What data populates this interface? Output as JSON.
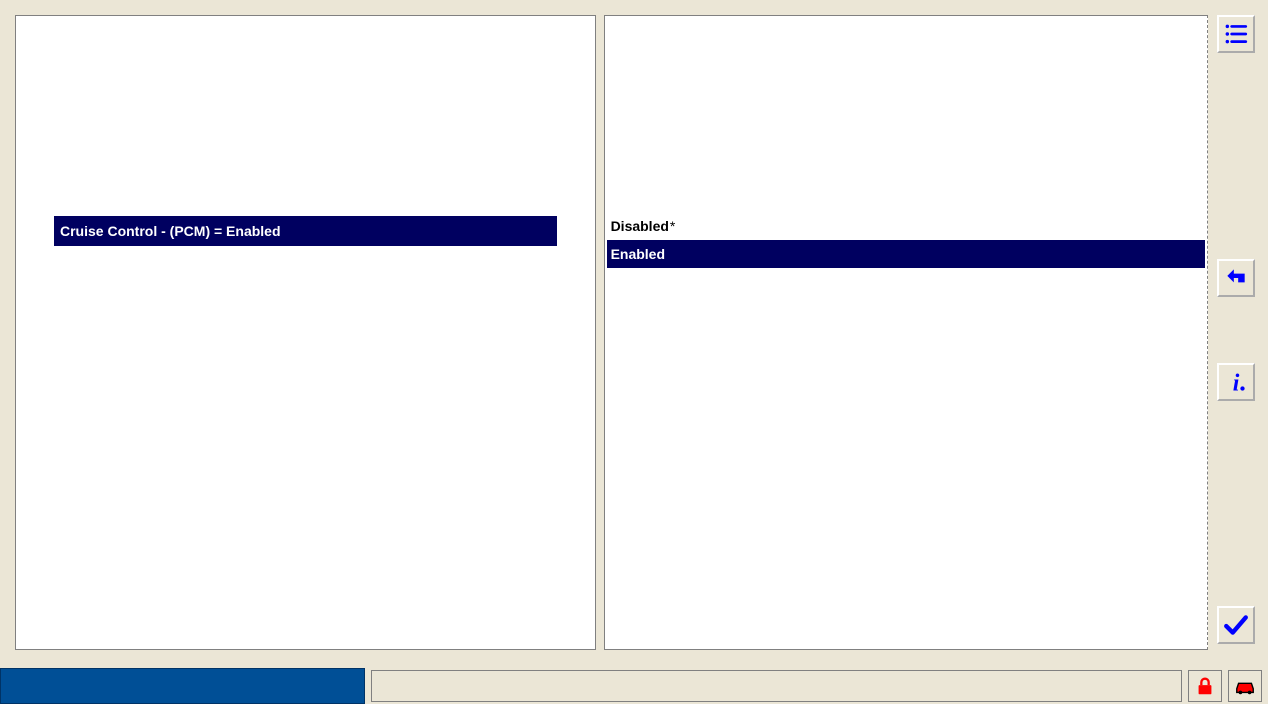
{
  "leftPanel": {
    "parameter_row": "Cruise Control - (PCM) = Enabled"
  },
  "rightPanel": {
    "options": [
      {
        "label": "Disabled",
        "star": "*",
        "selected": false
      },
      {
        "label": "Enabled",
        "star": "",
        "selected": true
      }
    ]
  },
  "sidebar": {
    "menu": "Menu",
    "back": "Back",
    "info": "Info",
    "apply": "Apply"
  },
  "bottom": {
    "status": "",
    "message": ""
  },
  "colors": {
    "selection": "#000060",
    "accent_blue": "#0000ff",
    "accent_red": "#ff0000",
    "status_bar": "#004f96"
  }
}
